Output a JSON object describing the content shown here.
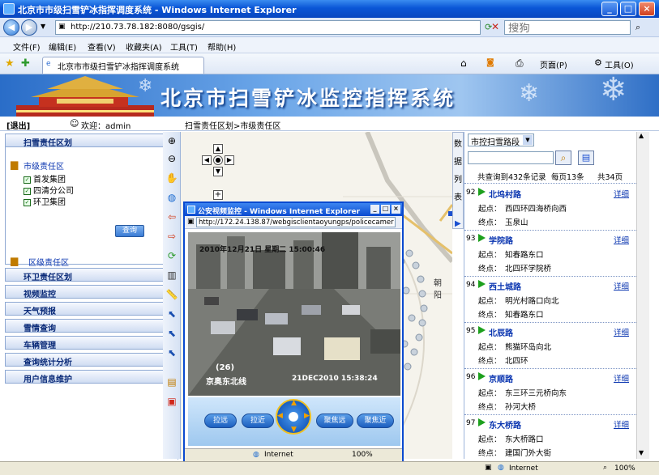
{
  "window": {
    "title": "北京市市级扫雪铲冰指挥调度系统 - Windows Internet Explorer",
    "controls": [
      "_",
      "□",
      "×"
    ]
  },
  "browser": {
    "url": "http://210.73.78.182:8080/gsgis/",
    "search_placeholder": "搜狗",
    "menu": [
      "文件(F)",
      "编辑(E)",
      "查看(V)",
      "收藏夹(A)",
      "工具(T)",
      "帮助(H)"
    ],
    "tab_title": "北京市市级扫雪铲冰指挥调度系统",
    "page_menu": "页面(P)",
    "tools_menu": "工具(O)",
    "status_zone": "Internet",
    "zoom": "100%"
  },
  "banner": {
    "title": "北京市扫雪铲冰监控指挥系统"
  },
  "top": {
    "logout": "[退出]",
    "welcome": "欢迎：admin",
    "breadcrumb": "扫雪责任区划>市级责任区"
  },
  "sidebar": {
    "sections": [
      "扫雪责任区划",
      "环卫责任区划",
      "视频监控",
      "天气预报",
      "雪情查询",
      "车辆管理",
      "查询统计分析",
      "用户信息维护"
    ],
    "city_zone": "市级责任区",
    "groups": [
      "首发集团",
      "四清分公司",
      "环卫集团"
    ],
    "query_button": "查询",
    "district_zone": "区级责任区"
  },
  "datatab": {
    "chars": [
      "数",
      "据",
      "列",
      "表"
    ]
  },
  "rightpanel": {
    "select_value": "市控扫雪路段",
    "summary": "共查询到432条记录",
    "per_page": "每页13条",
    "pages": "共34页",
    "start_label": "起点：",
    "end_label": "终点：",
    "detail_label": "详细",
    "roads": [
      {
        "num": "92",
        "name": "北坞村路",
        "start": "西四环四海桥向西",
        "end": "玉泉山"
      },
      {
        "num": "93",
        "name": "学院路",
        "start": "知春路东口",
        "end": "北四环学院桥"
      },
      {
        "num": "94",
        "name": "西土城路",
        "start": "明光村路口向北",
        "end": "知春路东口"
      },
      {
        "num": "95",
        "name": "北辰路",
        "start": "熊猫环岛向北",
        "end": "北四环"
      },
      {
        "num": "96",
        "name": "京顺路",
        "start": "东三环三元桥向东",
        "end": "孙河大桥"
      },
      {
        "num": "97",
        "name": "东大桥路",
        "start": "东大桥路口",
        "end": "建国门外大街"
      }
    ]
  },
  "popup": {
    "title": "公安视频监控 - Windows Internet Explorer",
    "url": "http://172.24.138.87/webgisclientaoyungps/policecamer",
    "video_datetime": "2010年12月21日  星期二  15:00:46",
    "video_channel": "(26)",
    "video_location": "京奥东北线",
    "video_stamp": "21DEC2010 15:38:24",
    "controls": [
      "拉远",
      "拉近",
      "聚焦远",
      "聚焦近"
    ],
    "status_zone": "Internet",
    "zoom": "100%"
  },
  "map": {
    "label_chaoyang": "朝 阳"
  }
}
